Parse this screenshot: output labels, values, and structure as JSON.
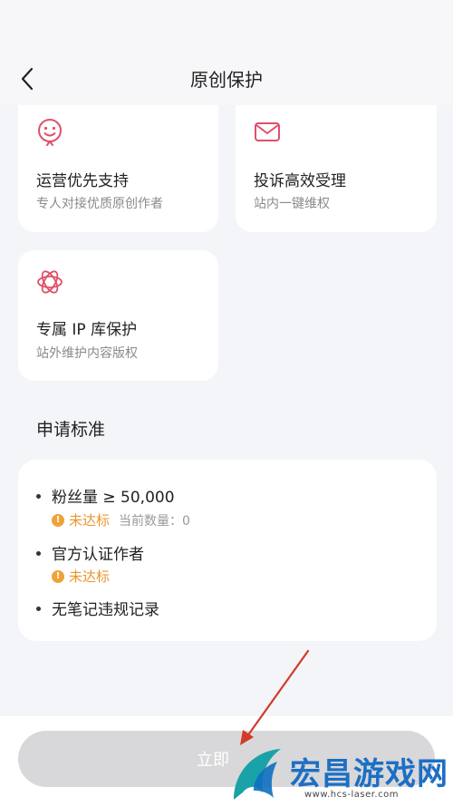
{
  "header": {
    "title": "原创保护",
    "back_icon": "chevron-left-icon"
  },
  "benefits": [
    {
      "icon": "smiley-badge-icon",
      "title": "运营优先支持",
      "subtitle": "专人对接优质原创作者"
    },
    {
      "icon": "envelope-icon",
      "title": "投诉高效受理",
      "subtitle": "站内一键维权"
    },
    {
      "icon": "atom-flower-icon",
      "title": "专属 IP 库保护",
      "subtitle": "站外维护内容版权"
    }
  ],
  "standards": {
    "title": "申请标准",
    "items": [
      {
        "label": "粉丝量 ≥ 50,000",
        "status": "未达标",
        "extra": "当前数量：0"
      },
      {
        "label": "官方认证作者",
        "status": "未达标"
      },
      {
        "label": "无笔记违规记录"
      }
    ]
  },
  "apply_button": {
    "label": "立即"
  },
  "watermark": {
    "brand": "宏昌游戏网",
    "url": "www.hcs-laser.com"
  },
  "colors": {
    "accent_pink": "#e0506a",
    "warning": "#f0a23a",
    "button_disabled": "#d8d8da",
    "arrow": "#d23a2a"
  }
}
